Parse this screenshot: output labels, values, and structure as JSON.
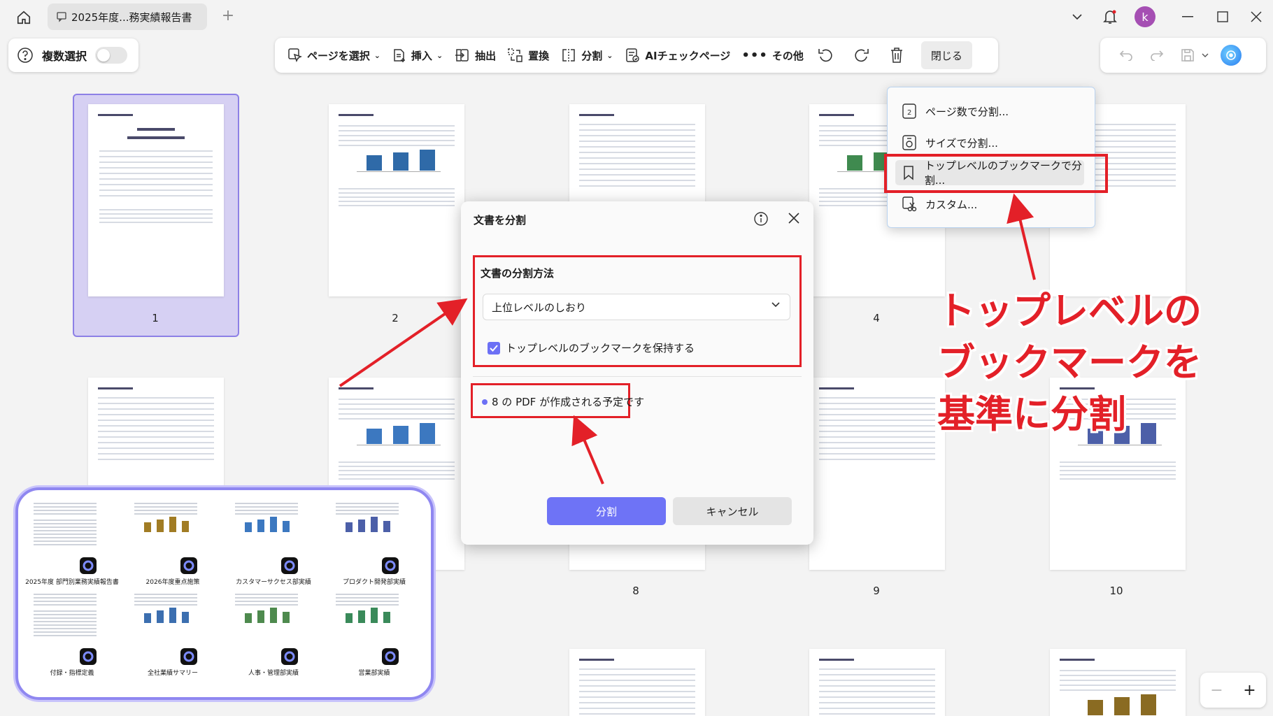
{
  "titlebar": {
    "tab_title": "2025年度...務実績報告書",
    "avatar_letter": "k",
    "add_tab": "+"
  },
  "toolbar": {
    "multi_select": "複数選択",
    "select_page": "ページを選択",
    "insert": "挿入",
    "extract": "抽出",
    "replace": "置換",
    "split": "分割",
    "ai_check": "AIチェックページ",
    "more": "その他",
    "close": "閉じる"
  },
  "pages": {
    "numbers": [
      "1",
      "2",
      "4",
      "8",
      "9",
      "10"
    ]
  },
  "dialog": {
    "title": "文書を分割",
    "method_label": "文書の分割方法",
    "method_value": "上位レベルのしおり",
    "keep_bookmark": "トップレベルのブックマークを保持する",
    "info": "8 の PDF が作成される予定です",
    "split_button": "分割",
    "cancel_button": "キャンセル"
  },
  "menu": {
    "items": [
      "ページ数で分割...",
      "サイズで分割...",
      "トップレベルのブックマークで分割...",
      "カスタム..."
    ]
  },
  "annotation": {
    "line1": "トップレベルの",
    "line2": "ブックマークを",
    "line3": "基準に分割"
  },
  "preview": {
    "labels": [
      "2025年度 部門別業務実績報告書",
      "2026年度重点施策",
      "カスタマーサクセス部実績",
      "プロダクト開発部実績",
      "付録・指標定義",
      "全社業績サマリー",
      "人事・管理部実績",
      "営業部実績"
    ]
  },
  "zoom": {
    "minus": "−",
    "plus": "+"
  },
  "colors": {
    "accent": "#6e73f6",
    "annotation_red": "#e32028",
    "avatar": "#a54fb3"
  }
}
